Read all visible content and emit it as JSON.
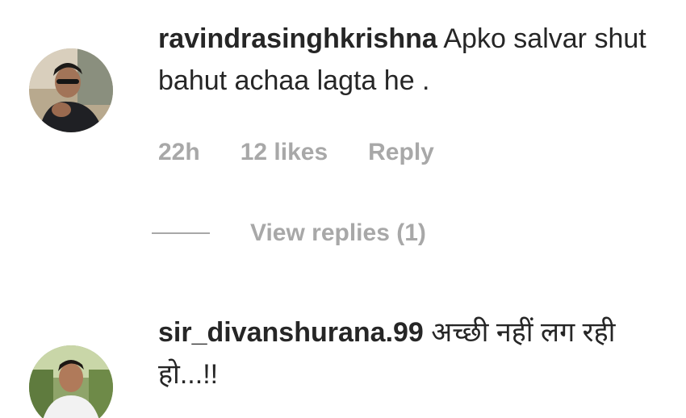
{
  "comments": [
    {
      "username": "ravindrasinghkrishna",
      "text": "Apko salvar shut bahut achaa lagta he .",
      "time": "22h",
      "likes": "12 likes",
      "reply_label": "Reply",
      "view_replies": "View replies (1)"
    },
    {
      "username": "sir_divanshurana.99",
      "text": "अच्छी नहीं लग रही हो...!!"
    }
  ]
}
